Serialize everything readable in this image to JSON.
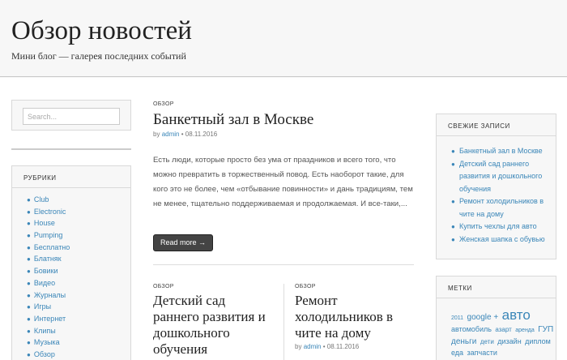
{
  "site": {
    "title": "Обзор новостей",
    "description": "Мини блог — галерея последних событий"
  },
  "search": {
    "placeholder": "Search..."
  },
  "categories": {
    "title": "РУБРИКИ",
    "items": [
      "Club",
      "Electronic",
      "House",
      "Pumping",
      "Бесплатно",
      "Блатняк",
      "Бовики",
      "Видео",
      "Журналы",
      "Игры",
      "Интернет",
      "Клипы",
      "Музыка",
      "Обзор"
    ]
  },
  "posts": [
    {
      "category": "ОБЗОР",
      "title": "Банкетный зал в Москве",
      "by": "by",
      "author": "admin",
      "date": "08.11.2016",
      "excerpt": "Есть люди, которые просто без ума от праздников и всего того, что можно превратить в торжественный повод. Есть наоборот такие, для кого это не более, чем «отбывание повинности» и дань традициям, тем не менее, тщательно поддерживаемая и продолжаемая. И все-таки,...",
      "read_more": "Read more →"
    },
    {
      "category": "ОБЗОР",
      "title": "Детский сад раннего развития и дошкольного обучения"
    },
    {
      "category": "ОБЗОР",
      "title": "Ремонт холодильников в чите на дому",
      "by": "by",
      "author": "admin",
      "date": "08.11.2016"
    }
  ],
  "recent": {
    "title": "СВЕЖИЕ ЗАПИСИ",
    "items": [
      "Банкетный зал в Москве",
      "Детский сад раннего развития и дошкольного обучения",
      "Ремонт холодильников в чите на дому",
      "Купить чехлы для авто",
      "Женская шапка с обувью"
    ]
  },
  "tags": {
    "title": "МЕТКИ",
    "items": [
      {
        "label": "2011",
        "size": 7
      },
      {
        "label": "google +",
        "size": 10
      },
      {
        "label": "авто",
        "size": 17
      },
      {
        "label": "автомобиль",
        "size": 9
      },
      {
        "label": "азарт",
        "size": 8
      },
      {
        "label": "аренда",
        "size": 7
      },
      {
        "label": "ГУП",
        "size": 10
      },
      {
        "label": "деньги",
        "size": 10
      },
      {
        "label": "дети",
        "size": 8
      },
      {
        "label": "дизайн",
        "size": 9
      },
      {
        "label": "диплом",
        "size": 9
      },
      {
        "label": "еда",
        "size": 9
      },
      {
        "label": "запчасти",
        "size": 9
      }
    ]
  },
  "colors": {
    "link": "#3a86b8",
    "text": "#555555",
    "button_bg": "#444444"
  }
}
